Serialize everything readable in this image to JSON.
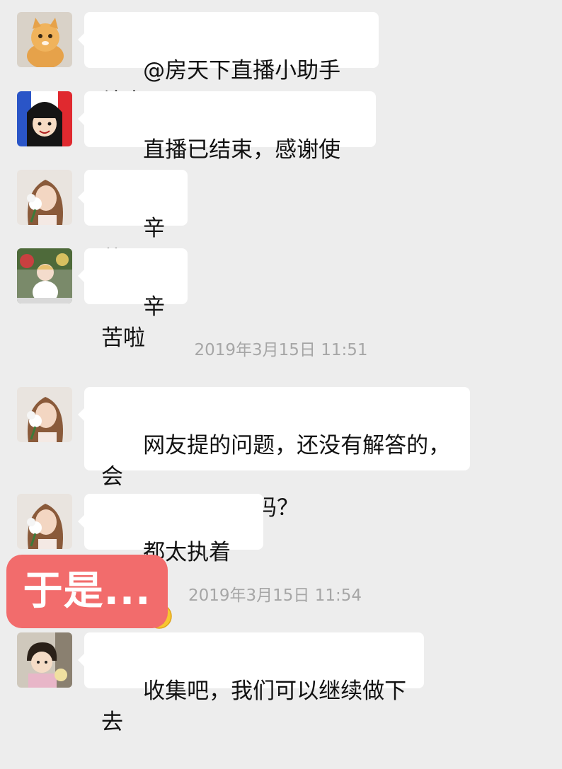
{
  "messages": [
    {
      "avatar": "cat-avatar",
      "text": "@房天下直播小助手 结束"
    },
    {
      "avatar": "cartoon-girl-avatar",
      "text": "直播已结束，感谢使用。"
    },
    {
      "avatar": "woman-flower-avatar",
      "text": "辛苦了"
    },
    {
      "avatar": "doll-avatar",
      "text": "辛苦啦"
    },
    {
      "avatar": "woman-flower-avatar",
      "text": "网友提的问题，还没有解答的，会\n有文字形式输出吗？"
    },
    {
      "avatar": "woman-flower-avatar",
      "text": "都太执着了",
      "emoji": "face-palm-emoji"
    },
    {
      "avatar": "child-avatar",
      "text": "收集吧，我们可以继续做下去"
    }
  ],
  "timestamps": [
    "2019年3月15日 11:51",
    "2019年3月15日 11:54"
  ],
  "overlay_label": "于是...",
  "colors": {
    "background": "#ededed",
    "bubble": "#ffffff",
    "timestamp": "#a6a6a6",
    "overlay": "#f26c6c"
  }
}
